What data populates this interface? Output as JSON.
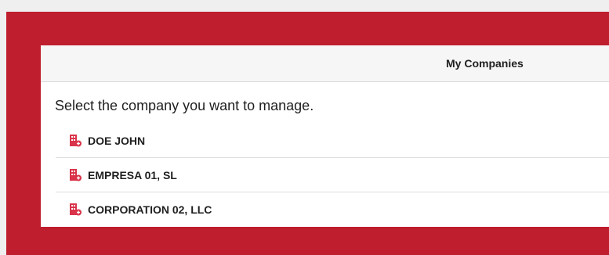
{
  "colors": {
    "brand_red": "#be1e2d",
    "panel_bg": "#ffffff",
    "header_bg": "#f6f6f6",
    "icon_color": "#d9344a"
  },
  "header": {
    "title": "My Companies"
  },
  "main": {
    "prompt": "Select the company you want to manage.",
    "companies": [
      {
        "name": "DOE JOHN",
        "icon": "building-add-icon"
      },
      {
        "name": "EMPRESA 01, SL",
        "icon": "building-add-icon"
      },
      {
        "name": "CORPORATION 02, LLC",
        "icon": "building-add-icon"
      }
    ]
  }
}
